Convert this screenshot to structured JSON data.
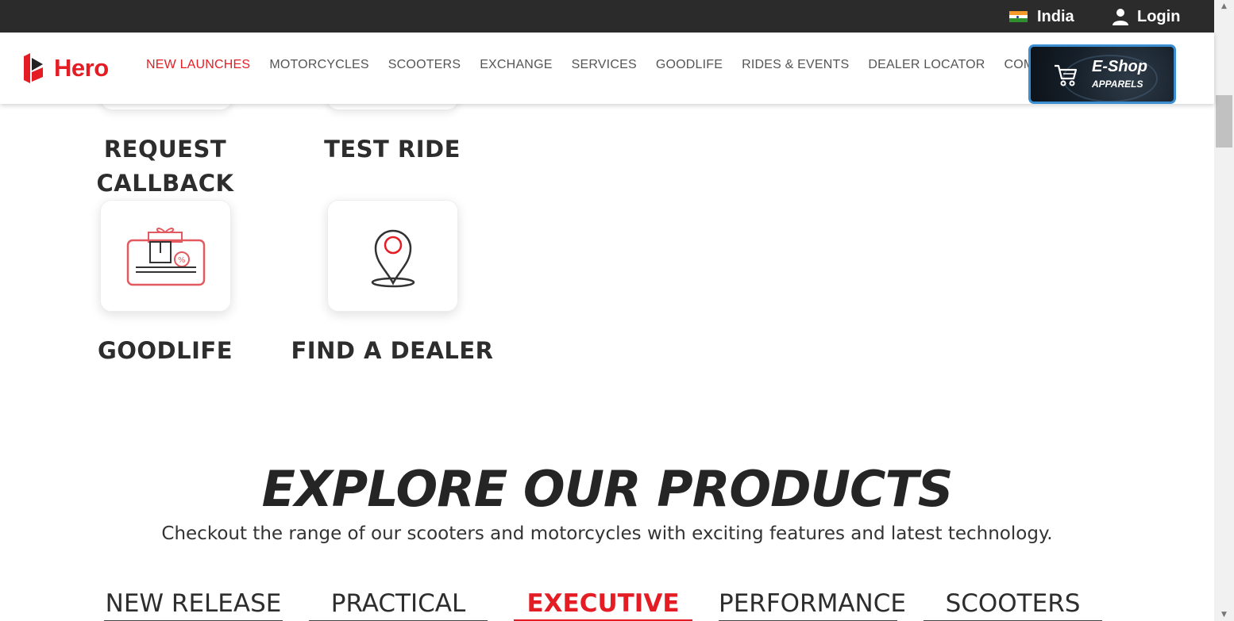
{
  "topbar": {
    "country": "India",
    "login": "Login"
  },
  "header": {
    "logo_text": "Hero",
    "menu": [
      {
        "label": "NEW LAUNCHES",
        "active": true
      },
      {
        "label": "MOTORCYCLES"
      },
      {
        "label": "SCOOTERS"
      },
      {
        "label": "EXCHANGE"
      },
      {
        "label": "SERVICES"
      },
      {
        "label": "GOODLIFE"
      },
      {
        "label": "RIDES & EVENTS"
      },
      {
        "label": "DEALER LOCATOR"
      },
      {
        "label": "COMPANY"
      }
    ],
    "eshop": {
      "title": "E-Shop",
      "subtitle": "APPAREL\u0000S"
    }
  },
  "quick_actions": {
    "request_callback_line1": "REQUEST",
    "request_callback_line2": "CALLBACK",
    "test_ride": "TEST RIDE",
    "goodlife": "GOODLIFE",
    "find_dealer": "FIND A DEALER"
  },
  "explore": {
    "title": "EXPLORE OUR PRODUCTS",
    "subtitle": "Checkout the range of our scooters and motorcycles with exciting features and latest technology.",
    "tabs": [
      {
        "label": "NEW RELEASE"
      },
      {
        "label": "PRACTICAL"
      },
      {
        "label": "EXECUTIVE",
        "active": true
      },
      {
        "label": "PERFORMANCE"
      },
      {
        "label": "SCOOTERS"
      }
    ]
  },
  "colors": {
    "brand_red": "#e41d25",
    "topbar_bg": "#2b2b2b",
    "text_dark": "#2d2d2d",
    "eshop_border": "#3a8ed1"
  },
  "icons": [
    "flag-india-icon",
    "user-icon",
    "hero-logo-icon",
    "cart-icon",
    "gift-card-icon",
    "map-pin-icon"
  ]
}
